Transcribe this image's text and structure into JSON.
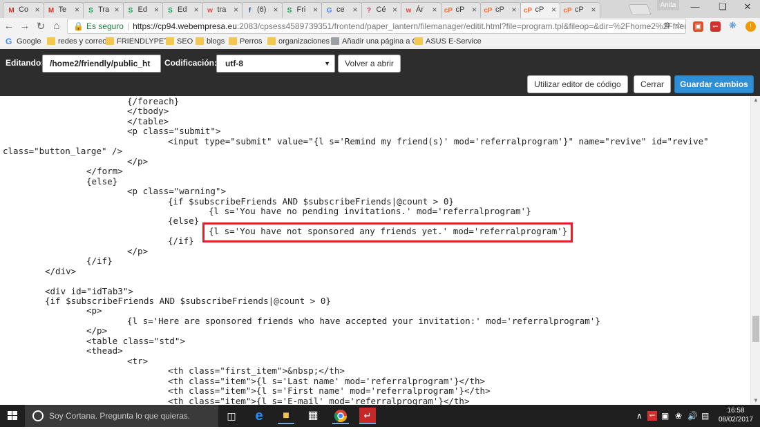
{
  "browser": {
    "tabs": [
      {
        "label": "Co",
        "favicon": "gmail-icon",
        "fav_text": "M",
        "fav_color": "#d93025"
      },
      {
        "label": "Te",
        "favicon": "gmail-icon",
        "fav_text": "M",
        "fav_color": "#d93025"
      },
      {
        "label": "Tra",
        "favicon": "sheets-icon",
        "fav_text": "S",
        "fav_color": "#0f9d58"
      },
      {
        "label": "Ed",
        "favicon": "sheets-icon",
        "fav_text": "S",
        "fav_color": "#0f9d58"
      },
      {
        "label": "Ed",
        "favicon": "sheets-icon",
        "fav_text": "S",
        "fav_color": "#0f9d58"
      },
      {
        "label": "tra",
        "favicon": "w-icon",
        "fav_text": "w",
        "fav_color": "#e8453c"
      },
      {
        "label": "(6)",
        "favicon": "facebook-icon",
        "fav_text": "f",
        "fav_color": "#3b5998"
      },
      {
        "label": "Fri",
        "favicon": "sheets-icon",
        "fav_text": "S",
        "fav_color": "#0f9d58"
      },
      {
        "label": "ce",
        "favicon": "google-icon",
        "fav_text": "G",
        "fav_color": "#4285f4"
      },
      {
        "label": "Cé",
        "favicon": "question-icon",
        "fav_text": "?",
        "fav_color": "#d62f6f"
      },
      {
        "label": "Ár",
        "favicon": "w-icon",
        "fav_text": "w",
        "fav_color": "#e8453c"
      },
      {
        "label": "cP",
        "favicon": "cpanel-icon",
        "fav_text": "cP",
        "fav_color": "#ff6c2c"
      },
      {
        "label": "cP",
        "favicon": "cpanel-icon",
        "fav_text": "cP",
        "fav_color": "#ff6c2c"
      },
      {
        "label": "cP",
        "favicon": "cpanel-icon",
        "fav_text": "cP",
        "fav_color": "#ff6c2c"
      },
      {
        "label": "cP",
        "favicon": "cpanel-icon",
        "fav_text": "cP",
        "fav_color": "#ff6c2c"
      }
    ],
    "active_tab_index": 13,
    "profile_name": "Anita",
    "secure_label": "Es seguro",
    "url_host": "https://cp94.webempresa.eu",
    "url_rest": ":2083/cpsess4589739351/frontend/paper_lantern/filemanager/editit.html?file=program.tpl&fileop=&dir=%2Fhome2%2Ffriend"
  },
  "bookmarks": [
    {
      "label": "Google",
      "icon": "google-icon"
    },
    {
      "label": "redes y correo",
      "icon": "folder-icon"
    },
    {
      "label": "FRIENDLYPET",
      "icon": "folder-icon"
    },
    {
      "label": "SEO",
      "icon": "folder-icon"
    },
    {
      "label": "blogs",
      "icon": "folder-icon"
    },
    {
      "label": "Perros",
      "icon": "folder-icon"
    },
    {
      "label": "organizaciones",
      "icon": "folder-icon"
    },
    {
      "label": "Añadir una página a C",
      "icon": "page-icon"
    },
    {
      "label": "ASUS E-Service",
      "icon": "folder-icon"
    }
  ],
  "editor": {
    "editing_label": "Editando:",
    "path_value": "/home2/friendly/public_ht",
    "encoding_label": "Codificación:",
    "encoding_value": "utf-8",
    "reopen_button": "Volver a abrir",
    "code_editor_button": "Utilizar editor de código",
    "close_button": "Cerrar",
    "save_button": "Guardar cambios"
  },
  "code_lines": [
    {
      "indent": 184,
      "text": "{/foreach}"
    },
    {
      "indent": 184,
      "text": "</tbody>"
    },
    {
      "indent": 184,
      "text": "</table>"
    },
    {
      "indent": 184,
      "text": "<p class=\"submit\">"
    },
    {
      "indent": 243,
      "text": "<input type=\"submit\" value=\"{l s='Remind my friend(s)' mod='referralprogram'}\" name=\"revive\" id=\"revive\""
    },
    {
      "indent": 4,
      "text": "class=\"button_large\" />"
    },
    {
      "indent": 184,
      "text": "</p>"
    },
    {
      "indent": 125,
      "text": "</form>"
    },
    {
      "indent": 125,
      "text": "{else}"
    },
    {
      "indent": 184,
      "text": "<p class=\"warning\">"
    },
    {
      "indent": 243,
      "text": "{if $subscribeFriends AND $subscribeFriends|@count > 0}"
    },
    {
      "indent": 302,
      "text": "{l s='You have no pending invitations.' mod='referralprogram'}"
    },
    {
      "indent": 243,
      "text": "{else}"
    },
    {
      "indent": 302,
      "text": "{l s='You have not sponsored any friends yet.' mod='referralprogram'}"
    },
    {
      "indent": 243,
      "text": "{/if}"
    },
    {
      "indent": 184,
      "text": "</p>"
    },
    {
      "indent": 125,
      "text": "{/if}"
    },
    {
      "indent": 65,
      "text": "</div>"
    },
    {
      "indent": 65,
      "text": ""
    },
    {
      "indent": 65,
      "text": "<div id=\"idTab3\">"
    },
    {
      "indent": 65,
      "text": "{if $subscribeFriends AND $subscribeFriends|@count > 0}"
    },
    {
      "indent": 125,
      "text": "<p>"
    },
    {
      "indent": 184,
      "text": "{l s='Here are sponsored friends who have accepted your invitation:' mod='referralprogram'}"
    },
    {
      "indent": 125,
      "text": "</p>"
    },
    {
      "indent": 125,
      "text": "<table class=\"std\">"
    },
    {
      "indent": 125,
      "text": "<thead>"
    },
    {
      "indent": 184,
      "text": "<tr>"
    },
    {
      "indent": 243,
      "text": "<th class=\"first_item\">&nbsp;</th>"
    },
    {
      "indent": 243,
      "text": "<th class=\"item\">{l s='Last name' mod='referralprogram'}</th>"
    },
    {
      "indent": 243,
      "text": "<th class=\"item\">{l s='First name' mod='referralprogram'}</th>"
    },
    {
      "indent": 243,
      "text": "<th class=\"item\">{l s='E-mail' mod='referralprogram'}</th>"
    }
  ],
  "taskbar": {
    "cortana_placeholder": "Soy Cortana. Pregunta lo que quieras.",
    "time": "16:58",
    "date": "08/02/2017"
  }
}
